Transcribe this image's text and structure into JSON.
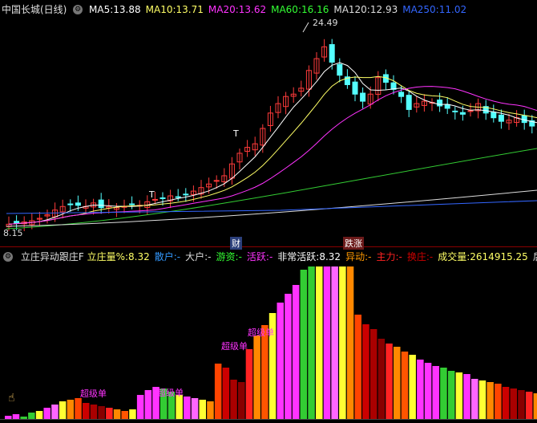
{
  "header": {
    "title": "中国长城(日线)",
    "ma": [
      {
        "label": "MA5:",
        "value": "13.88",
        "color": "#ffffff"
      },
      {
        "label": "MA10:",
        "value": "13.71",
        "color": "#ffff66"
      },
      {
        "label": "MA20:",
        "value": "13.62",
        "color": "#ff33ff"
      },
      {
        "label": "MA60:",
        "value": "16.16",
        "color": "#33ff33"
      },
      {
        "label": "MA120:",
        "value": "12.93",
        "color": "#dddddd"
      },
      {
        "label": "MA250:",
        "value": "11.02",
        "color": "#3366ff"
      }
    ]
  },
  "price_chart": {
    "high_label": "24.49",
    "low_label": "8.15",
    "tags": {
      "cai": "财",
      "diezhang": "跌涨"
    },
    "marker_t1": "T",
    "marker_t2": "T"
  },
  "indicator": {
    "title": "立庄异动跟庄F",
    "fields": [
      {
        "label": "立庄量%:",
        "value": "8.32",
        "color": "#ffff66"
      },
      {
        "label": "散户:",
        "value": "-",
        "color": "#3399ff"
      },
      {
        "label": "大户:",
        "value": "-",
        "color": "#dddddd"
      },
      {
        "label": "游资:",
        "value": "-",
        "color": "#33ff33"
      },
      {
        "label": "活跃:",
        "value": "-",
        "color": "#ff33ff"
      },
      {
        "label": "非常活跃:",
        "value": "8.32",
        "color": "#ffffff"
      },
      {
        "label": "异动:",
        "value": "-",
        "color": "#ff9900"
      },
      {
        "label": "主力:",
        "value": "-",
        "color": "#ff2222"
      },
      {
        "label": "换庄:",
        "value": "-",
        "color": "#cc0000"
      },
      {
        "label": "成交量:",
        "value": "2614915.25",
        "color": "#ffff66"
      },
      {
        "label": "后期",
        "value": "",
        "color": "#dddddd"
      }
    ],
    "super_label": "超级单",
    "money_label": "$"
  }
}
